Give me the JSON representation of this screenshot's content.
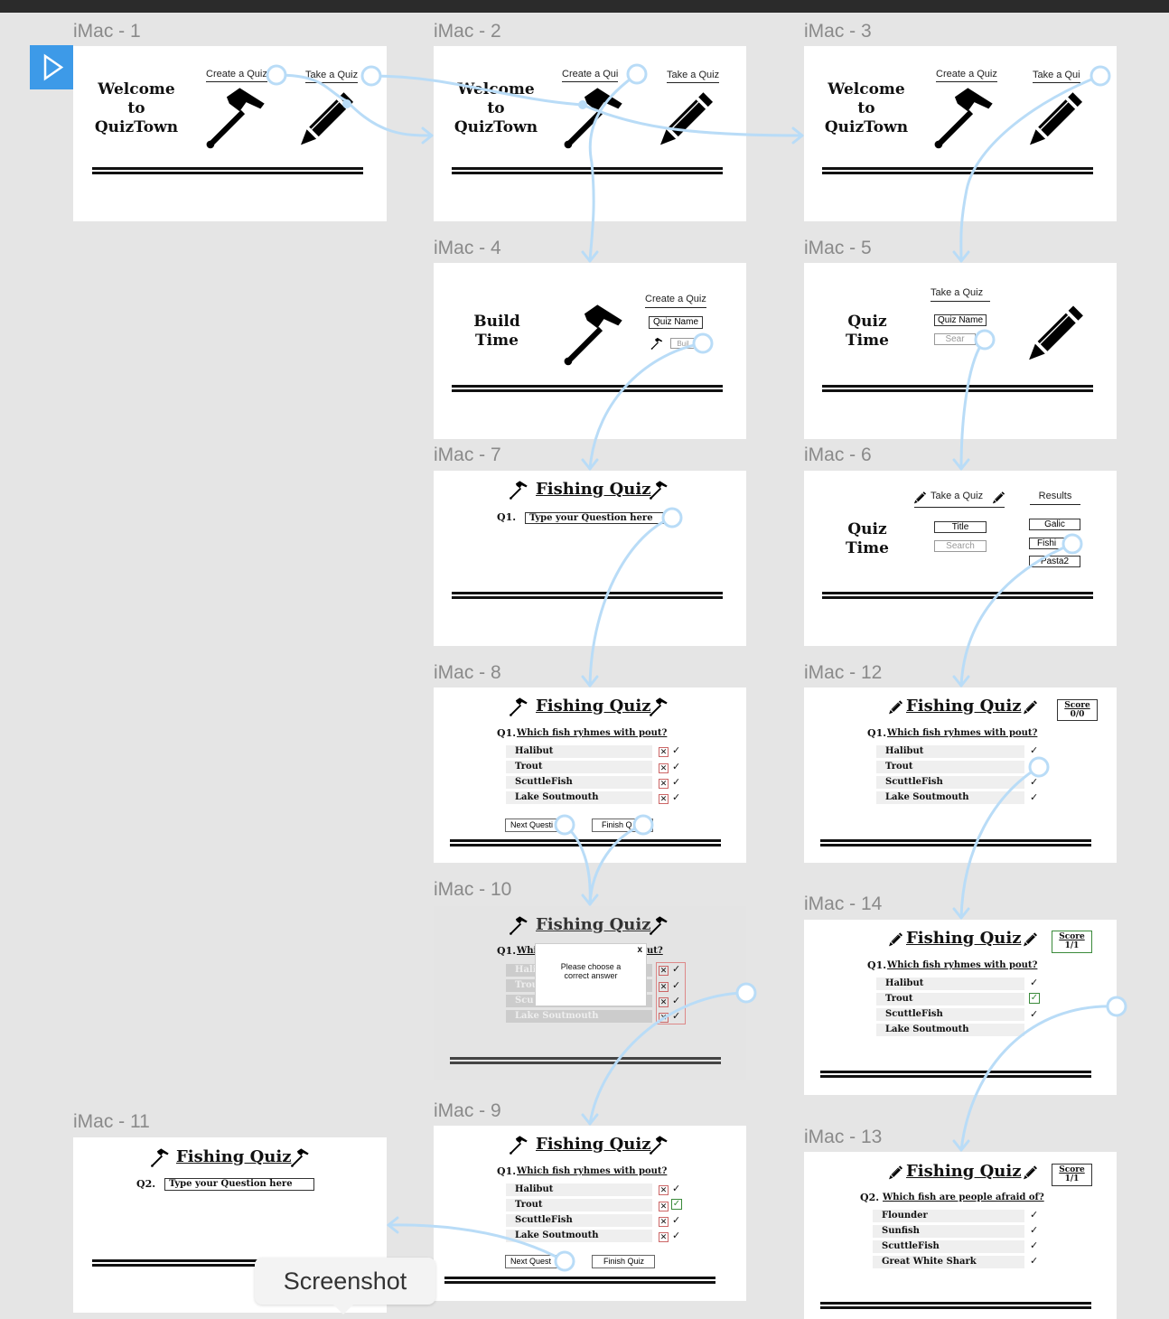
{
  "frame_labels": [
    "iMac - 1",
    "iMac - 2",
    "iMac - 3",
    "iMac - 4",
    "iMac - 5",
    "iMac - 7",
    "iMac - 6",
    "iMac - 8",
    "iMac - 12",
    "iMac - 10",
    "iMac - 14",
    "iMac - 11",
    "iMac - 9",
    "iMac - 13"
  ],
  "welcome": {
    "line1": "Welcome",
    "line2": "to",
    "line3": "QuizTown"
  },
  "nav": {
    "create": "Create a Quiz",
    "take": "Take a Quiz",
    "create_trunc": "Create a Qui",
    "take_trunc": "Take a Qui"
  },
  "build": {
    "line1": "Build",
    "line2": "Time",
    "header": "Create a Quiz",
    "quiz_name": "Quiz Name",
    "build_btn": "Buil"
  },
  "quiztime": {
    "line1": "Quiz",
    "line2": "Time",
    "header": "Take a Quiz",
    "quiz_name": "Quiz Name",
    "search": "Sear",
    "search_full": "Search",
    "title_btn": "Title"
  },
  "results": {
    "header": "Results",
    "items": [
      "Galic",
      "Fishi",
      "Pasta2"
    ]
  },
  "quiz": {
    "title": "Fishing Quiz",
    "q1": "Q1.",
    "q2": "Q2.",
    "placeholder": "Type your Question here",
    "q1_text": "Which fish ryhmes with pout?",
    "q2_text": "Which fish are people afraid of?",
    "q1_answers": [
      "Halibut",
      "Trout",
      "ScuttleFish",
      "Lake Soutmouth"
    ],
    "q2_answers": [
      "Flounder",
      "Sunfish",
      "ScuttleFish",
      "Great White Shark"
    ],
    "q1_answers_dim": [
      "Halib",
      "Trou",
      "Scu",
      "Lake Soutmouth"
    ],
    "q1_text_dim": "Whi",
    "q1_text_dim_end": "ut?",
    "next_btn": "Next Questi",
    "finish_btn": "Finish Q",
    "next_btn_9": "Next Quest",
    "finish_btn_9": "Finish Quiz",
    "score_label": "Score",
    "score_0": "0/0",
    "score_1": "1/1",
    "popup_line1": "Please choose a",
    "popup_line2": "correct answer",
    "popup_close": "x"
  },
  "marks": {
    "x": "✕",
    "check": "✓"
  },
  "tooltip": "Screenshot",
  "icons": {
    "play": "play-icon",
    "hammer": "hammer-icon",
    "pencil": "pencil-icon"
  },
  "colors": {
    "flow": "#b9dcf7",
    "accent": "#3d9ae8",
    "correct": "#3a8a3a"
  }
}
